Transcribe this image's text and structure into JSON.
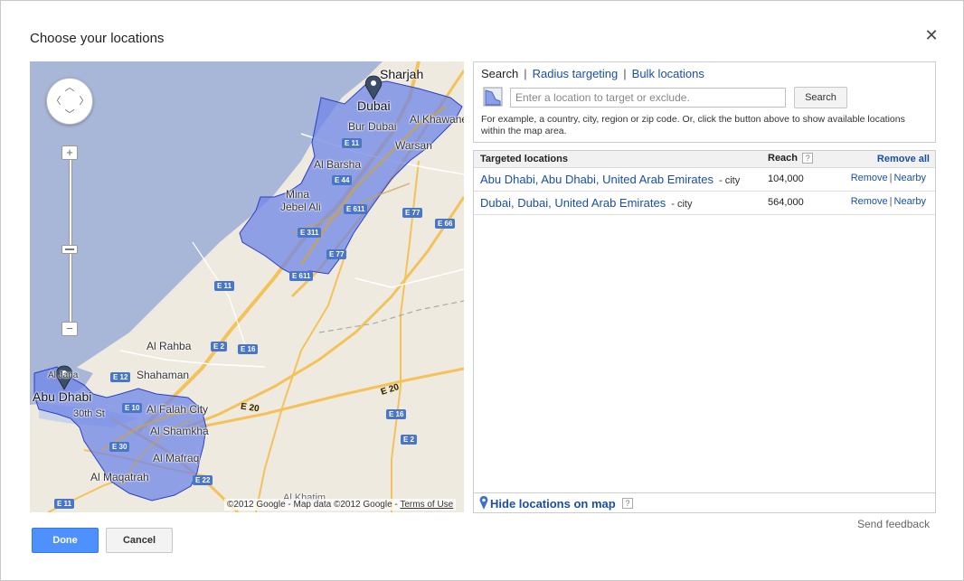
{
  "dialog": {
    "title": "Choose your locations",
    "close_icon": "close-icon"
  },
  "map": {
    "labels": {
      "sharjah": "Sharjah",
      "dubai": "Dubai",
      "bur_dubai": "Bur Dubai",
      "al_khawaneej": "Al Khawane",
      "warsan": "Warsan",
      "al_barsha": "Al Barsha",
      "mina": "Mina",
      "jebel_ali": "Jebel Ali",
      "al_rahba": "Al Rahba",
      "shahaman": "Shahaman",
      "al_jazeera": "Al Jana",
      "abu_dhabi": "Abu Dhabi",
      "thirtieth_st": "30th St",
      "al_falah_city": "Al Falah City",
      "al_shamkha": "Al Shamkha",
      "al_mafraq": "Al Mafraq",
      "al_maqatrah": "Al Maqatrah",
      "al_khatim": "Al Khatim"
    },
    "shields": {
      "e11_a": "E 11",
      "e44": "E 44",
      "e611_a": "E 611",
      "e311": "E 311",
      "e77_a": "E 77",
      "e611_b": "E 611",
      "e77_b": "E 77",
      "e66": "E 66",
      "e11_b": "E 11",
      "e2_a": "E 2",
      "e16_a": "E 16",
      "e12": "E 12",
      "e10": "E 10",
      "e30": "E 30",
      "e16_b": "E 16",
      "e2_b": "E 2",
      "e22": "E 22",
      "e11_c": "E 11",
      "e20": "E 20",
      "e20_b": "E 20"
    },
    "attribution": "©2012 Google - Map data ©2012 Google - ",
    "terms": "Terms of Use",
    "zoom_in": "+",
    "zoom_out": "−",
    "polygon_color": "#6f86e8"
  },
  "search": {
    "tab_search": "Search",
    "tab_radius": "Radius targeting",
    "tab_bulk": "Bulk locations",
    "separator": "|",
    "placeholder": "Enter a location to target or exclude.",
    "button": "Search",
    "hint": "For example, a country, city, region or zip code. Or, click the button above to show available locations within the map area."
  },
  "targeted": {
    "col_location": "Targeted locations",
    "col_reach": "Reach",
    "help": "?",
    "remove_all": "Remove all",
    "rows": [
      {
        "name": "Abu Dhabi, Abu Dhabi, United Arab Emirates",
        "type": "- city",
        "reach": "104,000",
        "remove": "Remove",
        "nearby": "Nearby"
      },
      {
        "name": "Dubai, Dubai, United Arab Emirates",
        "type": "- city",
        "reach": "564,000",
        "remove": "Remove",
        "nearby": "Nearby"
      }
    ],
    "action_sep": "|",
    "hide_link": "Hide locations on map"
  },
  "footer": {
    "send_feedback": "Send feedback",
    "done": "Done",
    "cancel": "Cancel"
  },
  "colors": {
    "link": "#1a4ea8",
    "done_button": "#4d90fe",
    "water": "#a8b7d8",
    "land": "#efeae0"
  }
}
